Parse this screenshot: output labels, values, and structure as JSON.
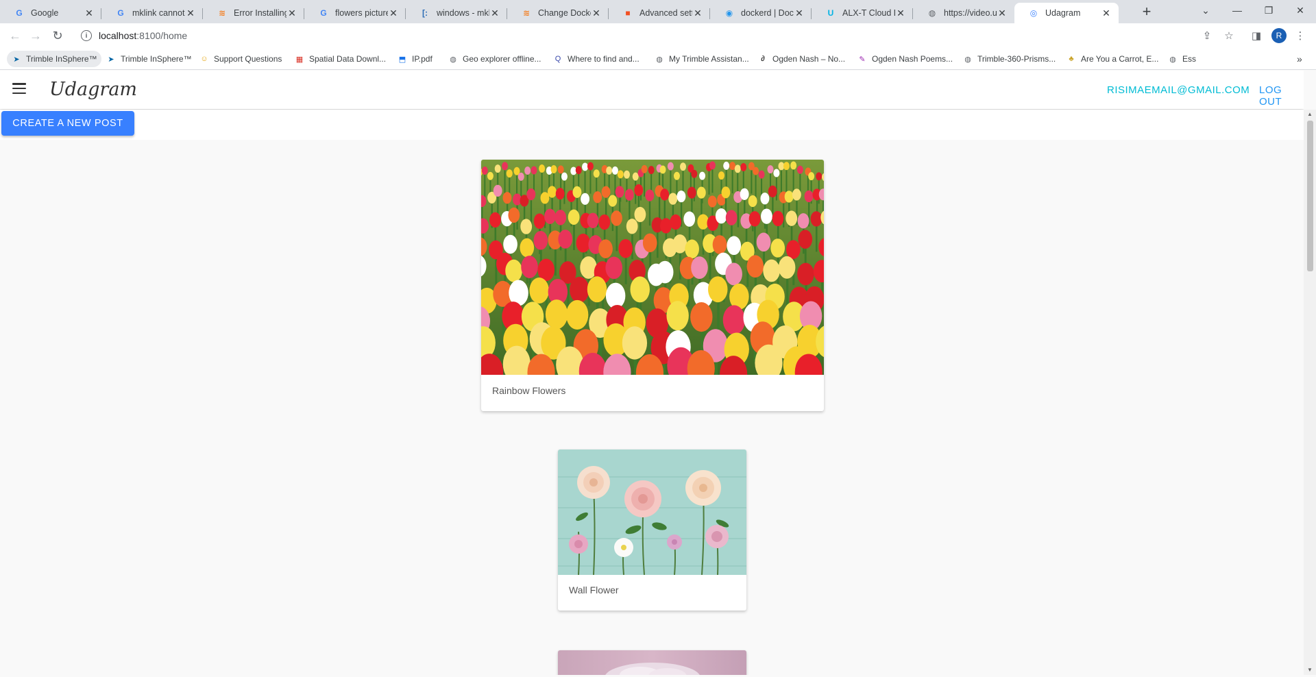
{
  "browser": {
    "tabs": [
      {
        "title": "Google",
        "icon": "google-icon",
        "iconColor": "#4285f4",
        "glyph": "G"
      },
      {
        "title": "mklink cannot c",
        "icon": "google-icon",
        "iconColor": "#4285f4",
        "glyph": "G"
      },
      {
        "title": "Error Installing D",
        "icon": "stackoverflow-icon",
        "iconColor": "#f48024",
        "glyph": "≋"
      },
      {
        "title": "flowers pictures",
        "icon": "google-icon",
        "iconColor": "#4285f4",
        "glyph": "G"
      },
      {
        "title": "windows - mklin",
        "icon": "superuser-icon",
        "iconColor": "#2d6db5",
        "glyph": "[:"
      },
      {
        "title": "Change Docker",
        "icon": "stackoverflow-icon",
        "iconColor": "#f48024",
        "glyph": "≋"
      },
      {
        "title": "Advanced settin",
        "icon": "microsoft-icon",
        "iconColor": "#f25022",
        "glyph": "■"
      },
      {
        "title": "dockerd | Docke",
        "icon": "docker-icon",
        "iconColor": "#2496ed",
        "glyph": "◉"
      },
      {
        "title": "ALX-T Cloud De",
        "icon": "udacity-icon",
        "iconColor": "#02b3e4",
        "glyph": "U"
      },
      {
        "title": "https://video.ud",
        "icon": "globe-icon",
        "iconColor": "#5f6368",
        "glyph": "◍"
      },
      {
        "title": "Udagram",
        "icon": "ionic-icon",
        "iconColor": "#3880ff",
        "glyph": "◎"
      }
    ],
    "address": {
      "host": "localhost",
      "path": ":8100/home"
    },
    "profileInitial": "R",
    "bookmarks": [
      {
        "label": "Trimble InSphere™",
        "icon": "trimble-icon",
        "glyph": "➤",
        "color": "#0063a3"
      },
      {
        "label": "Trimble InSphere™",
        "icon": "trimble-icon",
        "glyph": "➤",
        "color": "#0063a3"
      },
      {
        "label": "Support Questions",
        "icon": "support-icon",
        "glyph": "☺",
        "color": "#e6a817"
      },
      {
        "label": "Spatial Data Downl...",
        "icon": "grid-icon",
        "glyph": "▦",
        "color": "#d93025"
      },
      {
        "label": "IP.pdf",
        "icon": "pdf-icon",
        "glyph": "⬒",
        "color": "#1a73e8"
      },
      {
        "label": "Geo explorer offline...",
        "icon": "globe-icon",
        "glyph": "◍",
        "color": "#5f6368"
      },
      {
        "label": "Where to find and...",
        "icon": "search-icon",
        "glyph": "Q",
        "color": "#3949ab"
      },
      {
        "label": "My Trimble Assistan...",
        "icon": "globe-icon",
        "glyph": "◍",
        "color": "#5f6368"
      },
      {
        "label": "Ogden Nash – No...",
        "icon": "poetry-icon",
        "glyph": "∂",
        "color": "#000000"
      },
      {
        "label": "Ogden Nash Poems...",
        "icon": "pen-icon",
        "glyph": "✎",
        "color": "#9c27b0"
      },
      {
        "label": "Trimble-360-Prisms...",
        "icon": "globe-icon",
        "glyph": "◍",
        "color": "#5f6368"
      },
      {
        "label": "Are You a Carrot, E...",
        "icon": "carrot-icon",
        "glyph": "♣",
        "color": "#c9a227"
      },
      {
        "label": "Ess",
        "icon": "globe-icon",
        "glyph": "◍",
        "color": "#5f6368"
      }
    ],
    "moreBookmarks": "»"
  },
  "app": {
    "brand": "Udagram",
    "userEmail": "RISIMAEMAIL@GMAIL.COM",
    "logout": "LOG OUT",
    "createPost": "CREATE A NEW POST",
    "accent": "#3880ff"
  },
  "feed": [
    {
      "caption": "Rainbow Flowers",
      "image": "tulip-field"
    },
    {
      "caption": "Wall Flower",
      "image": "dahlias-on-teal-wall"
    },
    {
      "caption": "",
      "image": "pink-blossom"
    }
  ]
}
